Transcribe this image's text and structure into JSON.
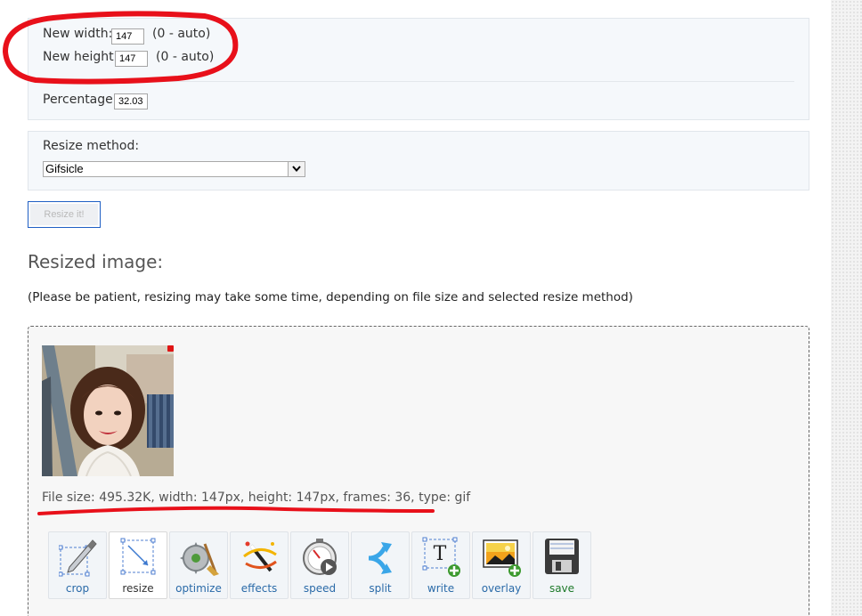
{
  "size_panel": {
    "width_label": "New width:",
    "width_value": "147",
    "width_hint": "(0 - auto)",
    "height_label": "New height:",
    "height_value": "147",
    "height_hint": "(0 - auto)",
    "percentage_label": "Percentage:",
    "percentage_value": "32.03"
  },
  "method_panel": {
    "label": "Resize method:",
    "selected": "Gifsicle"
  },
  "resize_button": "Resize it!",
  "result": {
    "heading": "Resized image:",
    "notice": "(Please be patient, resizing may take some time, depending on file size and selected resize method)",
    "file_info": "File size: 495.32K, width: 147px, height: 147px, frames: 36, type: gif"
  },
  "tools": [
    {
      "label": "crop",
      "icon": "crop-icon"
    },
    {
      "label": "resize",
      "icon": "resize-icon"
    },
    {
      "label": "optimize",
      "icon": "optimize-icon"
    },
    {
      "label": "effects",
      "icon": "effects-icon"
    },
    {
      "label": "speed",
      "icon": "speed-icon"
    },
    {
      "label": "split",
      "icon": "split-icon"
    },
    {
      "label": "write",
      "icon": "write-icon"
    },
    {
      "label": "overlay",
      "icon": "overlay-icon"
    },
    {
      "label": "save",
      "icon": "save-icon"
    }
  ],
  "colors": {
    "annotation": "#e8101a",
    "link": "#2a6aa8",
    "button_border": "#1f5fc4"
  }
}
